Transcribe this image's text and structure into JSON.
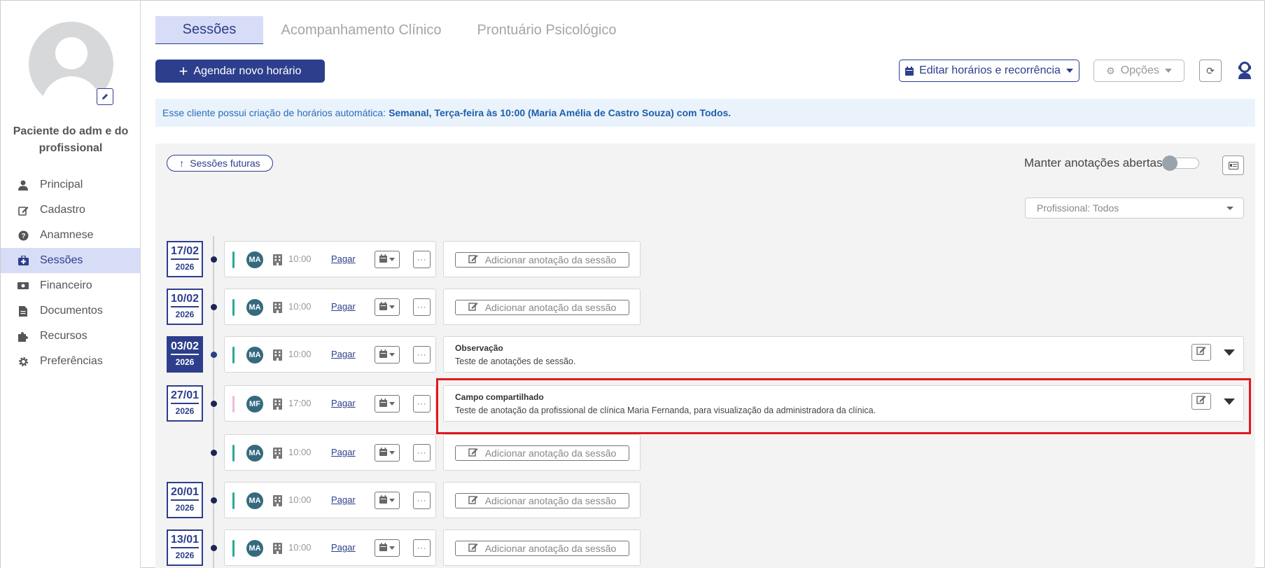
{
  "sidebar": {
    "patient_name": "Paciente do adm e do profissional",
    "items": [
      {
        "label": "Principal",
        "icon": "user-icon"
      },
      {
        "label": "Cadastro",
        "icon": "edit-icon"
      },
      {
        "label": "Anamnese",
        "icon": "question-icon"
      },
      {
        "label": "Sessões",
        "icon": "briefcase-medical-icon"
      },
      {
        "label": "Financeiro",
        "icon": "money-icon"
      },
      {
        "label": "Documentos",
        "icon": "file-icon"
      },
      {
        "label": "Recursos",
        "icon": "puzzle-icon"
      },
      {
        "label": "Preferências",
        "icon": "gear-icon"
      }
    ],
    "active_index": 3
  },
  "tabs": [
    "Sessões",
    "Acompanhamento Clínico",
    "Prontuário Psicológico"
  ],
  "toolbar": {
    "agendar_label": "Agendar novo horário",
    "editar_label": "Editar horários e recorrência",
    "opcoes_label": "Opções"
  },
  "info": {
    "prefix": "Esse cliente possui criação de horários automática:",
    "detail": "Semanal, Terça-feira às 10:00 (Maria Amélia de Castro Souza) com Todos."
  },
  "panel": {
    "futuras_label": "Sessões futuras",
    "manter_label": "Manter anotações abertas",
    "manter_on": false,
    "profissional_select": "Profissional: Todos"
  },
  "sessions": [
    {
      "day": "17/02",
      "year": "2026",
      "initials": "MA",
      "time": "10:00",
      "pay": "Pagar",
      "bar_color": "#2ba89b",
      "note": {
        "type": "add",
        "label": "Adicionar anotação da sessão"
      }
    },
    {
      "day": "10/02",
      "year": "2026",
      "initials": "MA",
      "time": "10:00",
      "pay": "Pagar",
      "bar_color": "#2ba89b",
      "note": {
        "type": "add",
        "label": "Adicionar anotação da sessão"
      }
    },
    {
      "day": "03/02",
      "year": "2026",
      "selected": true,
      "initials": "MA",
      "time": "10:00",
      "pay": "Pagar",
      "bar_color": "#2ba89b",
      "note": {
        "type": "full",
        "title": "Observação",
        "text": "Teste de anotações de sessão."
      }
    },
    {
      "day": "27/01",
      "year": "2026",
      "initials": "MF",
      "time": "17:00",
      "pay": "Pagar",
      "bar_color": "#f0b8e6",
      "note": {
        "type": "full",
        "title": "Campo compartilhado",
        "text": "Teste de anotação da profissional de clínica Maria Fernanda, para visualização da administradora da clínica."
      }
    },
    {
      "day": "",
      "year": "",
      "initials": "MA",
      "time": "10:00",
      "pay": "Pagar",
      "bar_color": "#2ba89b",
      "note": {
        "type": "add",
        "label": "Adicionar anotação da sessão"
      }
    },
    {
      "day": "20/01",
      "year": "2026",
      "initials": "MA",
      "time": "10:00",
      "pay": "Pagar",
      "bar_color": "#2ba89b",
      "note": {
        "type": "add",
        "label": "Adicionar anotação da sessão"
      }
    },
    {
      "day": "13/01",
      "year": "2026",
      "initials": "MA",
      "time": "10:00",
      "pay": "Pagar",
      "bar_color": "#2ba89b",
      "note": {
        "type": "add",
        "label": "Adicionar anotação da sessão"
      }
    }
  ],
  "colors": {
    "primary": "#2c3e8c",
    "highlight": "#e0191f",
    "info_bg": "#eaf3fc"
  }
}
